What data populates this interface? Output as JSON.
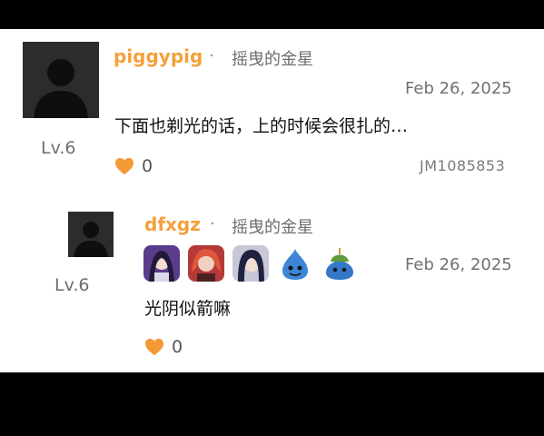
{
  "comment": {
    "username": "piggypig",
    "separator": "·",
    "title": "摇曳的金星",
    "date": "Feb 26, 2025",
    "level": "Lv.6",
    "text": "下面也剃光的话，上的时候会很扎的…",
    "likes": "0",
    "code": "JM1085853",
    "icons": {
      "avatar": "default-avatar-icon",
      "like": "heart-icon"
    }
  },
  "reply": {
    "username": "dfxgz",
    "separator": "·",
    "title": "摇曳的金星",
    "date": "Feb 26, 2025",
    "level": "Lv.6",
    "text": "光阴似箭嘛",
    "likes": "0",
    "badges": [
      "purple-hair-character-icon",
      "red-hair-character-icon",
      "dark-hair-character-icon",
      "blue-slime-icon",
      "armored-slime-icon"
    ]
  },
  "colors": {
    "username": "#f5a03a",
    "heart": "#f39a34",
    "background": "#ffffff",
    "letterbox": "#000000"
  }
}
